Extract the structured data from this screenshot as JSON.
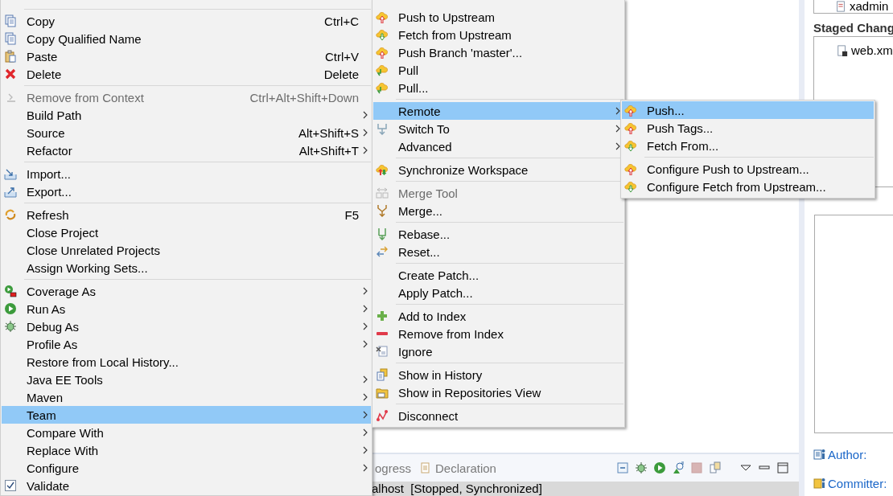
{
  "context_menu": {
    "items": [
      {
        "kind": "separator"
      },
      {
        "kind": "item",
        "label": "Copy",
        "shortcut": "Ctrl+C",
        "submenu": false,
        "disabled": false,
        "selected": false
      },
      {
        "kind": "item",
        "label": "Copy Qualified Name",
        "submenu": false,
        "disabled": false,
        "selected": false
      },
      {
        "kind": "item",
        "label": "Paste",
        "shortcut": "Ctrl+V",
        "submenu": false,
        "disabled": false,
        "selected": false
      },
      {
        "kind": "item",
        "label": "Delete",
        "shortcut": "Delete",
        "submenu": false,
        "disabled": false,
        "selected": false
      },
      {
        "kind": "separator"
      },
      {
        "kind": "item",
        "label": "Remove from Context",
        "shortcut": "Ctrl+Alt+Shift+Down",
        "submenu": false,
        "disabled": true,
        "selected": false
      },
      {
        "kind": "item",
        "label": "Build Path",
        "submenu": true,
        "disabled": false,
        "selected": false
      },
      {
        "kind": "item",
        "label": "Source",
        "shortcut": "Alt+Shift+S",
        "submenu": true,
        "disabled": false,
        "selected": false
      },
      {
        "kind": "item",
        "label": "Refactor",
        "shortcut": "Alt+Shift+T",
        "submenu": true,
        "disabled": false,
        "selected": false
      },
      {
        "kind": "separator"
      },
      {
        "kind": "item",
        "label": "Import...",
        "submenu": false,
        "disabled": false,
        "selected": false
      },
      {
        "kind": "item",
        "label": "Export...",
        "submenu": false,
        "disabled": false,
        "selected": false
      },
      {
        "kind": "separator"
      },
      {
        "kind": "item",
        "label": "Refresh",
        "shortcut": "F5",
        "submenu": false,
        "disabled": false,
        "selected": false
      },
      {
        "kind": "item",
        "label": "Close Project",
        "submenu": false,
        "disabled": false,
        "selected": false
      },
      {
        "kind": "item",
        "label": "Close Unrelated Projects",
        "submenu": false,
        "disabled": false,
        "selected": false
      },
      {
        "kind": "item",
        "label": "Assign Working Sets...",
        "submenu": false,
        "disabled": false,
        "selected": false
      },
      {
        "kind": "separator"
      },
      {
        "kind": "item",
        "label": "Coverage As",
        "submenu": true,
        "disabled": false,
        "selected": false
      },
      {
        "kind": "item",
        "label": "Run As",
        "submenu": true,
        "disabled": false,
        "selected": false
      },
      {
        "kind": "item",
        "label": "Debug As",
        "submenu": true,
        "disabled": false,
        "selected": false
      },
      {
        "kind": "item",
        "label": "Profile As",
        "submenu": true,
        "disabled": false,
        "selected": false
      },
      {
        "kind": "item",
        "label": "Restore from Local History...",
        "submenu": false,
        "disabled": false,
        "selected": false
      },
      {
        "kind": "item",
        "label": "Java EE Tools",
        "submenu": true,
        "disabled": false,
        "selected": false
      },
      {
        "kind": "item",
        "label": "Maven",
        "submenu": true,
        "disabled": false,
        "selected": false
      },
      {
        "kind": "item",
        "label": "Team",
        "submenu": true,
        "disabled": false,
        "selected": true
      },
      {
        "kind": "item",
        "label": "Compare With",
        "submenu": true,
        "disabled": false,
        "selected": false
      },
      {
        "kind": "item",
        "label": "Replace With",
        "submenu": true,
        "disabled": false,
        "selected": false
      },
      {
        "kind": "item",
        "label": "Configure",
        "submenu": true,
        "disabled": false,
        "selected": false
      },
      {
        "kind": "check",
        "label": "Validate",
        "checked": true,
        "submenu": false,
        "disabled": false,
        "selected": false
      }
    ]
  },
  "team_menu": {
    "items": [
      {
        "kind": "item",
        "label": "Push to Upstream",
        "submenu": false,
        "disabled": false,
        "selected": false
      },
      {
        "kind": "item",
        "label": "Fetch from Upstream",
        "submenu": false,
        "disabled": false,
        "selected": false
      },
      {
        "kind": "item",
        "label": "Push Branch 'master'...",
        "submenu": false,
        "disabled": false,
        "selected": false
      },
      {
        "kind": "item",
        "label": "Pull",
        "submenu": false,
        "disabled": false,
        "selected": false
      },
      {
        "kind": "item",
        "label": "Pull...",
        "submenu": false,
        "disabled": false,
        "selected": false
      },
      {
        "kind": "separator"
      },
      {
        "kind": "item",
        "label": "Remote",
        "submenu": true,
        "disabled": false,
        "selected": true
      },
      {
        "kind": "item",
        "label": "Switch To",
        "submenu": true,
        "disabled": false,
        "selected": false
      },
      {
        "kind": "item",
        "label": "Advanced",
        "submenu": true,
        "disabled": false,
        "selected": false
      },
      {
        "kind": "separator"
      },
      {
        "kind": "item",
        "label": "Synchronize Workspace",
        "submenu": false,
        "disabled": false,
        "selected": false
      },
      {
        "kind": "separator"
      },
      {
        "kind": "item",
        "label": "Merge Tool",
        "submenu": false,
        "disabled": true,
        "selected": false
      },
      {
        "kind": "item",
        "label": "Merge...",
        "submenu": false,
        "disabled": false,
        "selected": false
      },
      {
        "kind": "separator"
      },
      {
        "kind": "item",
        "label": "Rebase...",
        "submenu": false,
        "disabled": false,
        "selected": false
      },
      {
        "kind": "item",
        "label": "Reset...",
        "submenu": false,
        "disabled": false,
        "selected": false
      },
      {
        "kind": "separator"
      },
      {
        "kind": "item",
        "label": "Create Patch...",
        "submenu": false,
        "disabled": false,
        "selected": false
      },
      {
        "kind": "item",
        "label": "Apply Patch...",
        "submenu": false,
        "disabled": false,
        "selected": false
      },
      {
        "kind": "separator"
      },
      {
        "kind": "item",
        "label": "Add to Index",
        "submenu": false,
        "disabled": false,
        "selected": false
      },
      {
        "kind": "item",
        "label": "Remove from Index",
        "submenu": false,
        "disabled": false,
        "selected": false
      },
      {
        "kind": "item",
        "label": "Ignore",
        "submenu": false,
        "disabled": false,
        "selected": false
      },
      {
        "kind": "separator"
      },
      {
        "kind": "item",
        "label": "Show in History",
        "submenu": false,
        "disabled": false,
        "selected": false
      },
      {
        "kind": "item",
        "label": "Show in Repositories View",
        "submenu": false,
        "disabled": false,
        "selected": false
      },
      {
        "kind": "separator"
      },
      {
        "kind": "item",
        "label": "Disconnect",
        "submenu": false,
        "disabled": false,
        "selected": false
      }
    ]
  },
  "remote_menu": {
    "items": [
      {
        "kind": "item",
        "label": "Push...",
        "submenu": false,
        "disabled": false,
        "selected": true
      },
      {
        "kind": "item",
        "label": "Push Tags...",
        "submenu": false,
        "disabled": false,
        "selected": false
      },
      {
        "kind": "item",
        "label": "Fetch From...",
        "submenu": false,
        "disabled": false,
        "selected": false
      },
      {
        "kind": "separator"
      },
      {
        "kind": "item",
        "label": "Configure Push to Upstream...",
        "submenu": false,
        "disabled": false,
        "selected": false
      },
      {
        "kind": "item",
        "label": "Configure Fetch from Upstream...",
        "submenu": false,
        "disabled": false,
        "selected": false
      }
    ]
  },
  "bottom_panel": {
    "tabs": [
      {
        "label": "ogress"
      },
      {
        "label": "Declaration"
      }
    ],
    "rows": [
      {
        "label": "alhost  [Stopped, Synchronized]",
        "selected": true
      }
    ]
  },
  "staging_panel": {
    "unstaged_files": [
      "xadmin"
    ],
    "staged_title": "Staged Chang",
    "staged_files": [
      "web.xm"
    ],
    "author_label": "Author:",
    "committer_label": "Committer:"
  }
}
